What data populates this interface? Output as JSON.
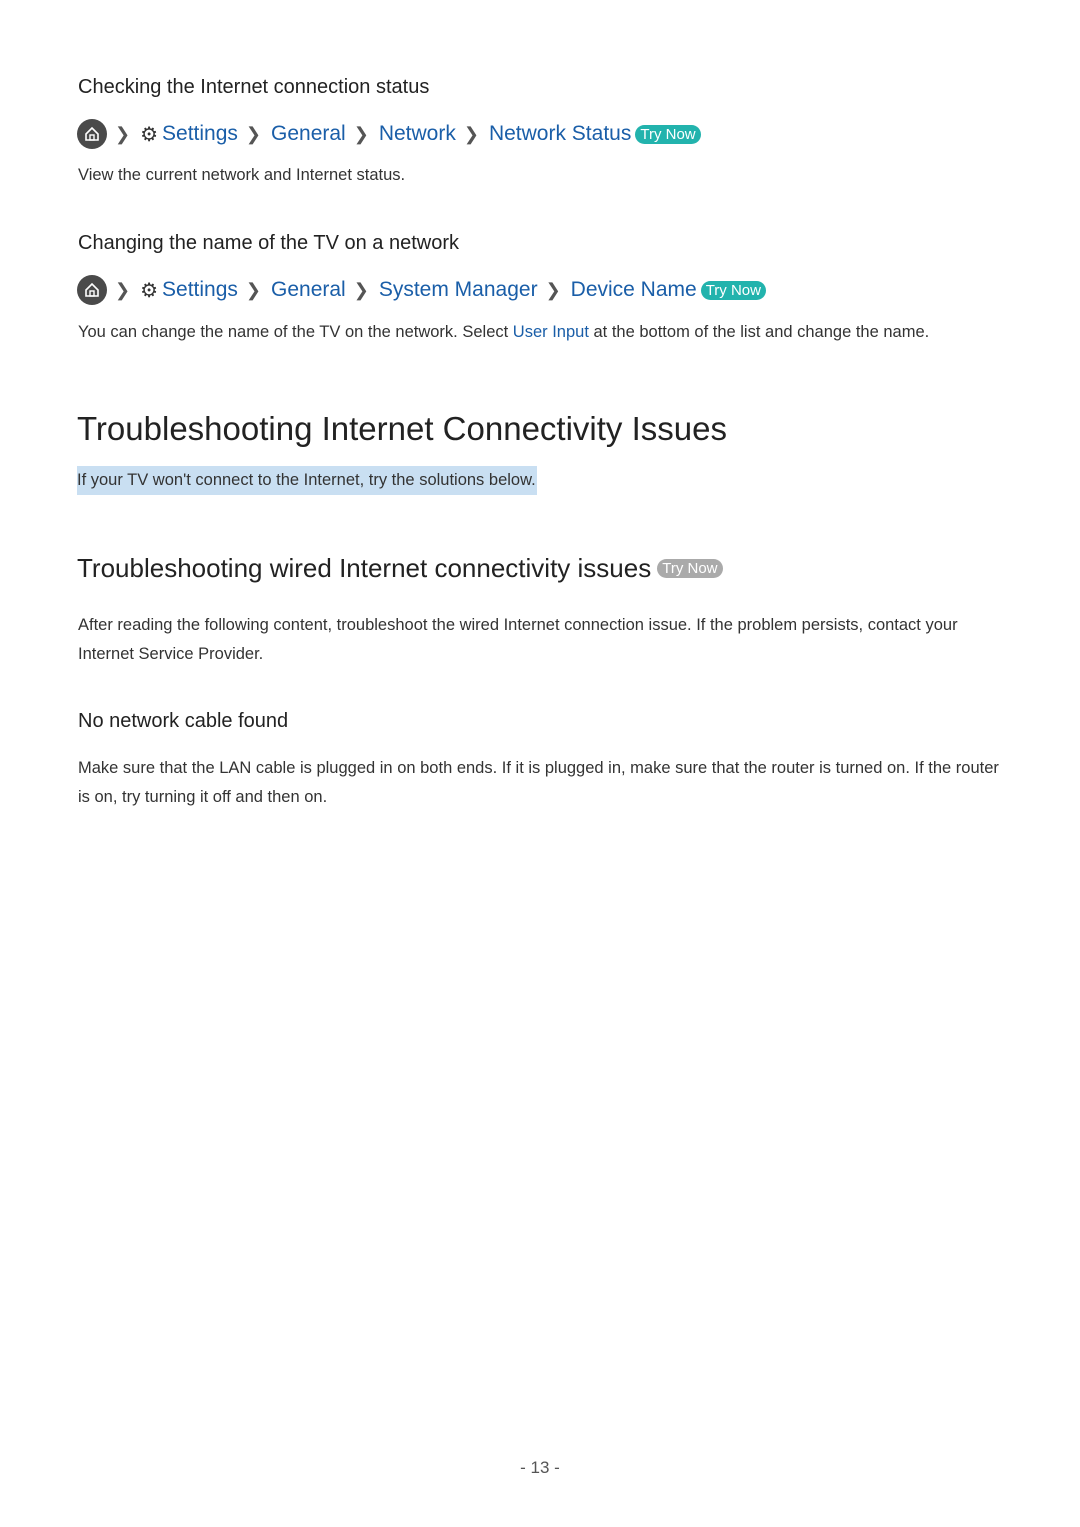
{
  "section1": {
    "heading": "Checking the Internet connection status",
    "breadcrumb": [
      "Settings",
      "General",
      "Network",
      "Network Status"
    ],
    "try_now": "Try Now",
    "description": "View the current network and Internet status."
  },
  "section2": {
    "heading": "Changing the name of the TV on a network",
    "breadcrumb": [
      "Settings",
      "General",
      "System Manager",
      "Device Name"
    ],
    "try_now": "Try Now",
    "desc_before": "You can change the name of the TV on the network. Select ",
    "desc_link": "User Input",
    "desc_after": " at the bottom of the list and change the name."
  },
  "main": {
    "title": "Troubleshooting Internet Connectivity Issues",
    "intro": "If your TV won't connect to the Internet, try the solutions below."
  },
  "wired": {
    "title": "Troubleshooting wired Internet connectivity issues",
    "try_now": "Try Now",
    "paragraph": "After reading the following content, troubleshoot the wired Internet connection issue. If the problem persists, contact your Internet Service Provider.",
    "sub_heading": "No network cable found",
    "sub_paragraph": "Make sure that the LAN cable is plugged in on both ends. If it is plugged in, make sure that the router is turned on. If the router is on, try turning it off and then on."
  },
  "page_number": "- 13 -"
}
